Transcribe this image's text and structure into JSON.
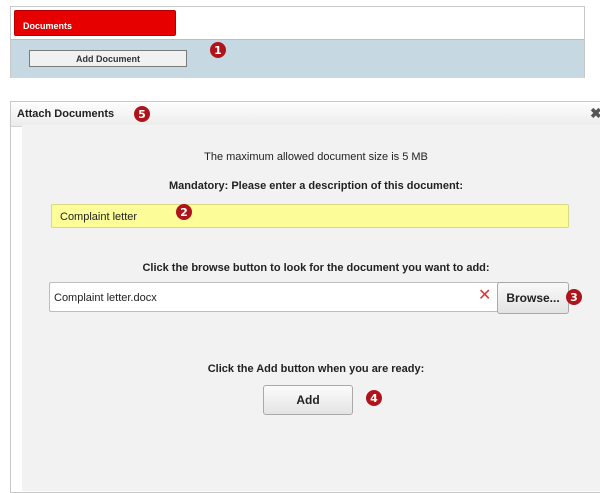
{
  "documents_panel": {
    "tab_label": "Documents",
    "add_button_label": "Add Document"
  },
  "dialog": {
    "title": "Attach Documents",
    "close_glyph": "✖",
    "size_notice": "The maximum allowed document size is 5 MB",
    "description_prompt": "Mandatory: Please enter a description of this document:",
    "description_value": "Complaint letter",
    "browse_prompt": "Click the browse button to look for the document you want to add:",
    "file_value": "Complaint letter.docx",
    "clear_glyph": "✕",
    "browse_label": "Browse...",
    "add_prompt": "Click the Add button when you are ready:",
    "add_label": "Add"
  },
  "callouts": {
    "one": "1",
    "two": "2",
    "three": "3",
    "four": "4",
    "five": "5"
  },
  "colors": {
    "tab_red": "#e60000",
    "callout_red": "#b0141b",
    "toolbar_blue": "#c6d9e2",
    "field_yellow": "#fcfc99",
    "dialog_gray": "#f2f2f2"
  }
}
